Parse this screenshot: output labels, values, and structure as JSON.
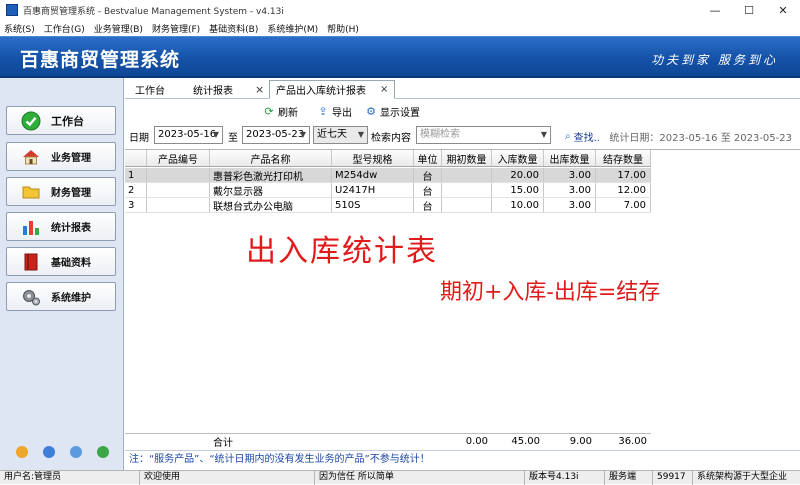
{
  "window": {
    "title": "百惠商贸管理系统 - Bestvalue Management System - v4.13i",
    "minimize": "—",
    "maximize": "☐",
    "close": "✕"
  },
  "menu": [
    "系统(S)",
    "工作台(G)",
    "业务管理(B)",
    "财务管理(F)",
    "基础资料(B)",
    "系统维护(M)",
    "帮助(H)"
  ],
  "banner": {
    "brand": "百惠商贸管理系统",
    "slogan": "功夫到家 服务到心"
  },
  "nav": [
    {
      "label": "工作台",
      "icon": "check-circle-icon",
      "active": true
    },
    {
      "label": "业务管理",
      "icon": "house-icon"
    },
    {
      "label": "财务管理",
      "icon": "folder-icon"
    },
    {
      "label": "统计报表",
      "icon": "chart-icon"
    },
    {
      "label": "基础资料",
      "icon": "book-icon"
    },
    {
      "label": "系统维护",
      "icon": "gears-icon"
    }
  ],
  "tabs": [
    {
      "label": "工作台"
    },
    {
      "label": "统计报表"
    },
    {
      "label": "产品出入库统计报表",
      "active": true
    }
  ],
  "toolbar": {
    "refresh": "刷新",
    "export": "导出",
    "display_settings": "显示设置"
  },
  "filters": {
    "date_label": "日期",
    "date_from": "2023-05-16",
    "to_label": "至",
    "date_to": "2023-05-23",
    "range": "近七天",
    "search_label": "检索内容",
    "search_placeholder": "模糊检索",
    "find": "查找..",
    "stat_date": "统计日期：2023-05-16 至 2023-05-23"
  },
  "table": {
    "columns": [
      "",
      "产品编号",
      "产品名称",
      "型号规格",
      "单位",
      "期初数量",
      "入库数量",
      "出库数量",
      "结存数量"
    ],
    "rows": [
      [
        "1",
        "",
        "惠普彩色激光打印机",
        "M254dw",
        "台",
        "",
        "20.00",
        "3.00",
        "17.00"
      ],
      [
        "2",
        "",
        "戴尔显示器",
        "U2417H",
        "台",
        "",
        "15.00",
        "3.00",
        "12.00"
      ],
      [
        "3",
        "",
        "联想台式办公电脑",
        "510S",
        "台",
        "",
        "10.00",
        "3.00",
        "7.00"
      ]
    ],
    "total": [
      "",
      "",
      "合计",
      "",
      "",
      "0.00",
      "45.00",
      "9.00",
      "36.00"
    ]
  },
  "annotations": {
    "title": "出入库统计表",
    "formula": "期初+入库-出库=结存"
  },
  "note": "注：“服务产品”、“统计日期内的没有发生业务的产品”不参与统计！",
  "status": {
    "user": "用户名:管理员",
    "welcome": "欢迎使用",
    "motto": "因为信任 所以简单",
    "version": "版本号4.13i",
    "server": "服务端",
    "port": "59917",
    "arch": "系统架构源于大型企业"
  },
  "colors": {
    "banner": "#1552a8",
    "annotation": "#e11b1b",
    "note": "#1b47a8"
  }
}
